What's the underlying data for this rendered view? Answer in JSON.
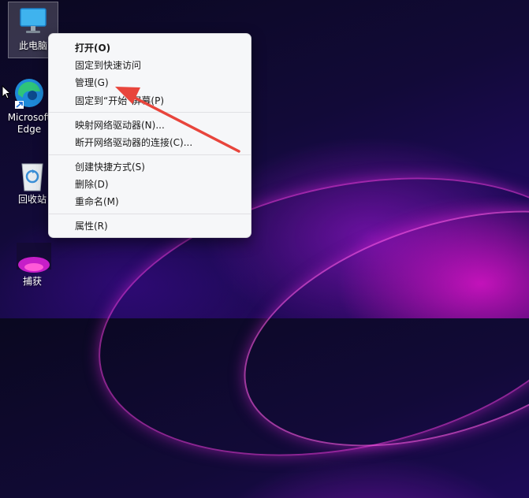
{
  "desktop": {
    "icons": [
      {
        "name": "this-pc",
        "label": "此电脑"
      },
      {
        "name": "edge",
        "label": "Microsoft Edge"
      },
      {
        "name": "recycle-bin",
        "label": "回收站"
      },
      {
        "name": "capture",
        "label": "捕获"
      }
    ]
  },
  "context_menu": {
    "items": [
      {
        "label": "打开(O)"
      },
      {
        "label": "固定到快速访问"
      },
      {
        "label": "管理(G)"
      },
      {
        "label": "固定到“开始”屏幕(P)"
      },
      {
        "label": "映射网络驱动器(N)..."
      },
      {
        "label": "断开网络驱动器的连接(C)..."
      },
      {
        "label": "创建快捷方式(S)"
      },
      {
        "label": "删除(D)"
      },
      {
        "label": "重命名(M)"
      },
      {
        "label": "属性(R)"
      }
    ]
  },
  "annotation": {
    "color": "#e8453c"
  }
}
